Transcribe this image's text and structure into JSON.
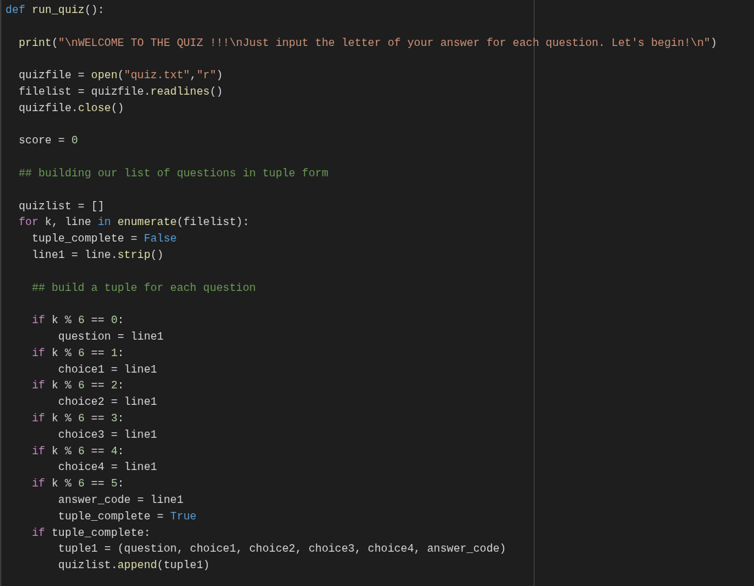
{
  "editor": {
    "lines": [
      {
        "kind": "code",
        "tokens": [
          {
            "kind": "keyword",
            "text": "def "
          },
          {
            "kind": "function",
            "text": "run_quiz"
          },
          {
            "kind": "plain",
            "text": "():"
          }
        ],
        "children": [
          {
            "kind": "blank"
          },
          {
            "kind": "code",
            "tokens": [
              {
                "kind": "function",
                "text": "print"
              },
              {
                "kind": "plain",
                "text": "("
              },
              {
                "kind": "string",
                "text": "\"\\nWELCOME TO THE QUIZ !!!\\nJust input the letter of your answer for each question. Let's begin!\\n\""
              },
              {
                "kind": "plain",
                "text": ")"
              }
            ]
          },
          {
            "kind": "blank"
          },
          {
            "kind": "code",
            "tokens": [
              {
                "kind": "plain",
                "text": "quizfile = "
              },
              {
                "kind": "function",
                "text": "open"
              },
              {
                "kind": "plain",
                "text": "("
              },
              {
                "kind": "string",
                "text": "\"quiz.txt\""
              },
              {
                "kind": "plain",
                "text": ","
              },
              {
                "kind": "string",
                "text": "\"r\""
              },
              {
                "kind": "plain",
                "text": ")"
              }
            ]
          },
          {
            "kind": "code",
            "tokens": [
              {
                "kind": "plain",
                "text": "filelist = quizfile."
              },
              {
                "kind": "function",
                "text": "readlines"
              },
              {
                "kind": "plain",
                "text": "()"
              }
            ]
          },
          {
            "kind": "code",
            "tokens": [
              {
                "kind": "plain",
                "text": "quizfile."
              },
              {
                "kind": "function",
                "text": "close"
              },
              {
                "kind": "plain",
                "text": "()"
              }
            ]
          },
          {
            "kind": "blank"
          },
          {
            "kind": "code",
            "tokens": [
              {
                "kind": "plain",
                "text": "score = "
              },
              {
                "kind": "number",
                "text": "0"
              }
            ]
          },
          {
            "kind": "blank"
          },
          {
            "kind": "code",
            "tokens": [
              {
                "kind": "comment",
                "text": "## building our list of questions in tuple form"
              }
            ]
          },
          {
            "kind": "blank"
          },
          {
            "kind": "code",
            "tokens": [
              {
                "kind": "plain",
                "text": "quizlist = []"
              }
            ]
          },
          {
            "kind": "code",
            "tokens": [
              {
                "kind": "control",
                "text": "for"
              },
              {
                "kind": "plain",
                "text": " k, line "
              },
              {
                "kind": "keyword",
                "text": "in"
              },
              {
                "kind": "function",
                "text": " enumerate"
              },
              {
                "kind": "plain",
                "text": "(filelist):"
              }
            ],
            "children": [
              {
                "kind": "code",
                "tokens": [
                  {
                    "kind": "plain",
                    "text": "tuple_complete = "
                  },
                  {
                    "kind": "keyword",
                    "text": "False"
                  }
                ]
              },
              {
                "kind": "code",
                "tokens": [
                  {
                    "kind": "plain",
                    "text": "line1 = line."
                  },
                  {
                    "kind": "function",
                    "text": "strip"
                  },
                  {
                    "kind": "plain",
                    "text": "()"
                  }
                ]
              },
              {
                "kind": "blank"
              },
              {
                "kind": "code",
                "tokens": [
                  {
                    "kind": "comment",
                    "text": "## build a tuple for each question"
                  }
                ]
              },
              {
                "kind": "blank"
              },
              {
                "kind": "code",
                "tokens": [
                  {
                    "kind": "control",
                    "text": "if"
                  },
                  {
                    "kind": "plain",
                    "text": " k % "
                  },
                  {
                    "kind": "number",
                    "text": "6"
                  },
                  {
                    "kind": "plain",
                    "text": " == "
                  },
                  {
                    "kind": "number",
                    "text": "0"
                  },
                  {
                    "kind": "plain",
                    "text": ":"
                  }
                ],
                "children": [
                  {
                    "kind": "code",
                    "tokens": [
                      {
                        "kind": "plain",
                        "text": "question = line1"
                      }
                    ]
                  }
                ]
              },
              {
                "kind": "code",
                "tokens": [
                  {
                    "kind": "control",
                    "text": "if"
                  },
                  {
                    "kind": "plain",
                    "text": " k % "
                  },
                  {
                    "kind": "number",
                    "text": "6"
                  },
                  {
                    "kind": "plain",
                    "text": " == "
                  },
                  {
                    "kind": "number",
                    "text": "1"
                  },
                  {
                    "kind": "plain",
                    "text": ":"
                  }
                ],
                "children": [
                  {
                    "kind": "code",
                    "tokens": [
                      {
                        "kind": "plain",
                        "text": "choice1 = line1"
                      }
                    ]
                  }
                ]
              },
              {
                "kind": "code",
                "tokens": [
                  {
                    "kind": "control",
                    "text": "if"
                  },
                  {
                    "kind": "plain",
                    "text": " k % "
                  },
                  {
                    "kind": "number",
                    "text": "6"
                  },
                  {
                    "kind": "plain",
                    "text": " == "
                  },
                  {
                    "kind": "number",
                    "text": "2"
                  },
                  {
                    "kind": "plain",
                    "text": ":"
                  }
                ],
                "children": [
                  {
                    "kind": "code",
                    "tokens": [
                      {
                        "kind": "plain",
                        "text": "choice2 = line1"
                      }
                    ]
                  }
                ]
              },
              {
                "kind": "code",
                "tokens": [
                  {
                    "kind": "control",
                    "text": "if"
                  },
                  {
                    "kind": "plain",
                    "text": " k % "
                  },
                  {
                    "kind": "number",
                    "text": "6"
                  },
                  {
                    "kind": "plain",
                    "text": " == "
                  },
                  {
                    "kind": "number",
                    "text": "3"
                  },
                  {
                    "kind": "plain",
                    "text": ":"
                  }
                ],
                "children": [
                  {
                    "kind": "code",
                    "tokens": [
                      {
                        "kind": "plain",
                        "text": "choice3 = line1"
                      }
                    ]
                  }
                ]
              },
              {
                "kind": "code",
                "tokens": [
                  {
                    "kind": "control",
                    "text": "if"
                  },
                  {
                    "kind": "plain",
                    "text": " k % "
                  },
                  {
                    "kind": "number",
                    "text": "6"
                  },
                  {
                    "kind": "plain",
                    "text": " == "
                  },
                  {
                    "kind": "number",
                    "text": "4"
                  },
                  {
                    "kind": "plain",
                    "text": ":"
                  }
                ],
                "children": [
                  {
                    "kind": "code",
                    "tokens": [
                      {
                        "kind": "plain",
                        "text": "choice4 = line1"
                      }
                    ]
                  }
                ]
              },
              {
                "kind": "code",
                "tokens": [
                  {
                    "kind": "control",
                    "text": "if"
                  },
                  {
                    "kind": "plain",
                    "text": " k % "
                  },
                  {
                    "kind": "number",
                    "text": "6"
                  },
                  {
                    "kind": "plain",
                    "text": " == "
                  },
                  {
                    "kind": "number",
                    "text": "5"
                  },
                  {
                    "kind": "plain",
                    "text": ":"
                  }
                ],
                "children": [
                  {
                    "kind": "code",
                    "tokens": [
                      {
                        "kind": "plain",
                        "text": "answer_code = line1"
                      }
                    ]
                  },
                  {
                    "kind": "code",
                    "tokens": [
                      {
                        "kind": "plain",
                        "text": "tuple_complete = "
                      },
                      {
                        "kind": "keyword",
                        "text": "True"
                      }
                    ]
                  }
                ]
              },
              {
                "kind": "code",
                "tokens": [
                  {
                    "kind": "control",
                    "text": "if"
                  },
                  {
                    "kind": "plain",
                    "text": " tuple_complete:"
                  }
                ],
                "children": [
                  {
                    "kind": "code",
                    "tokens": [
                      {
                        "kind": "plain",
                        "text": "tuple1 = (question, choice1, choice2, choice3, choice4, answer_code)"
                      }
                    ]
                  },
                  {
                    "kind": "code",
                    "tokens": [
                      {
                        "kind": "plain",
                        "text": "quizlist."
                      },
                      {
                        "kind": "function",
                        "text": "append"
                      },
                      {
                        "kind": "plain",
                        "text": "(tuple1)"
                      }
                    ]
                  }
                ]
              }
            ]
          }
        ]
      }
    ]
  }
}
